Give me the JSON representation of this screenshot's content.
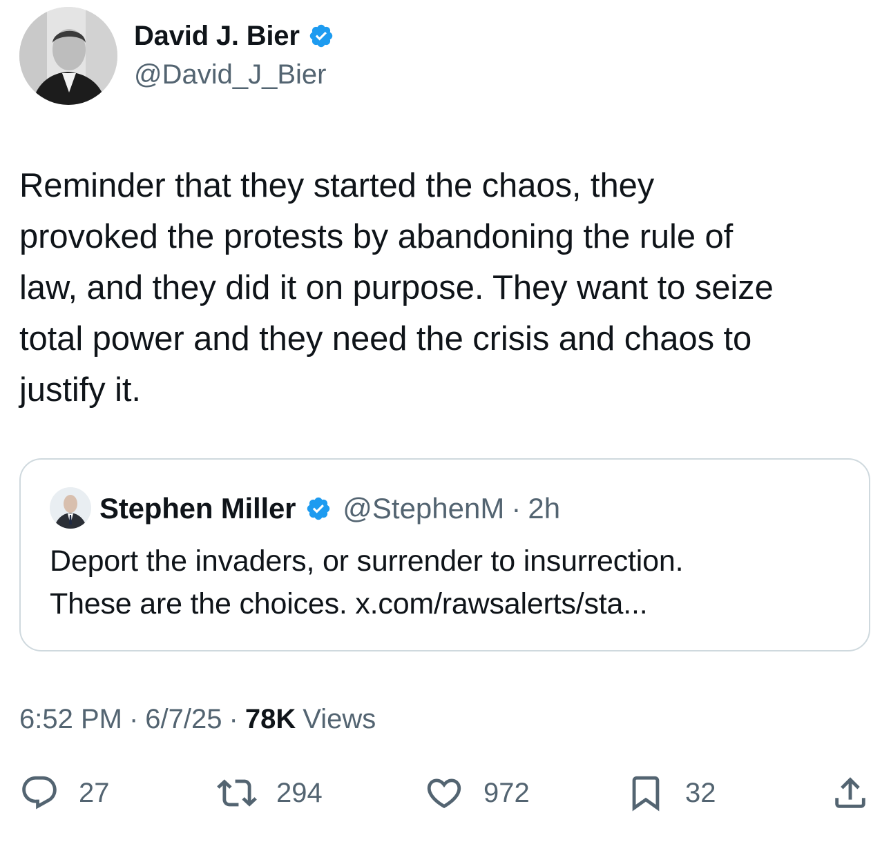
{
  "tweet": {
    "author": {
      "display_name": "David J. Bier",
      "handle": "@David_J_Bier",
      "verified": true,
      "avatar_icon": "profile-photo"
    },
    "text": "Reminder that they started the chaos, they\nprovoked the protests by abandoning the rule of\nlaw, and they did it on purpose. They want to seize\ntotal power and they need the crisis and chaos to\njustify it.",
    "quote": {
      "author": {
        "display_name": "Stephen Miller",
        "handle": "@StephenM",
        "verified": true,
        "avatar_icon": "profile-photo"
      },
      "separator": "·",
      "time": "2h",
      "text": "Deport the invaders, or surrender to insurrection.\nThese are the choices. x.com/rawsalerts/sta..."
    },
    "meta": {
      "time": "6:52 PM",
      "separator": "·",
      "date": "6/7/25",
      "views_count": "78K",
      "views_label": "Views"
    },
    "actions": {
      "replies": "27",
      "reposts": "294",
      "likes": "972",
      "bookmarks": "32"
    },
    "colors": {
      "verified_blue": "#1d9bf0",
      "text_primary": "#0f1419",
      "text_secondary": "#536471",
      "border": "#cfd9de"
    }
  }
}
